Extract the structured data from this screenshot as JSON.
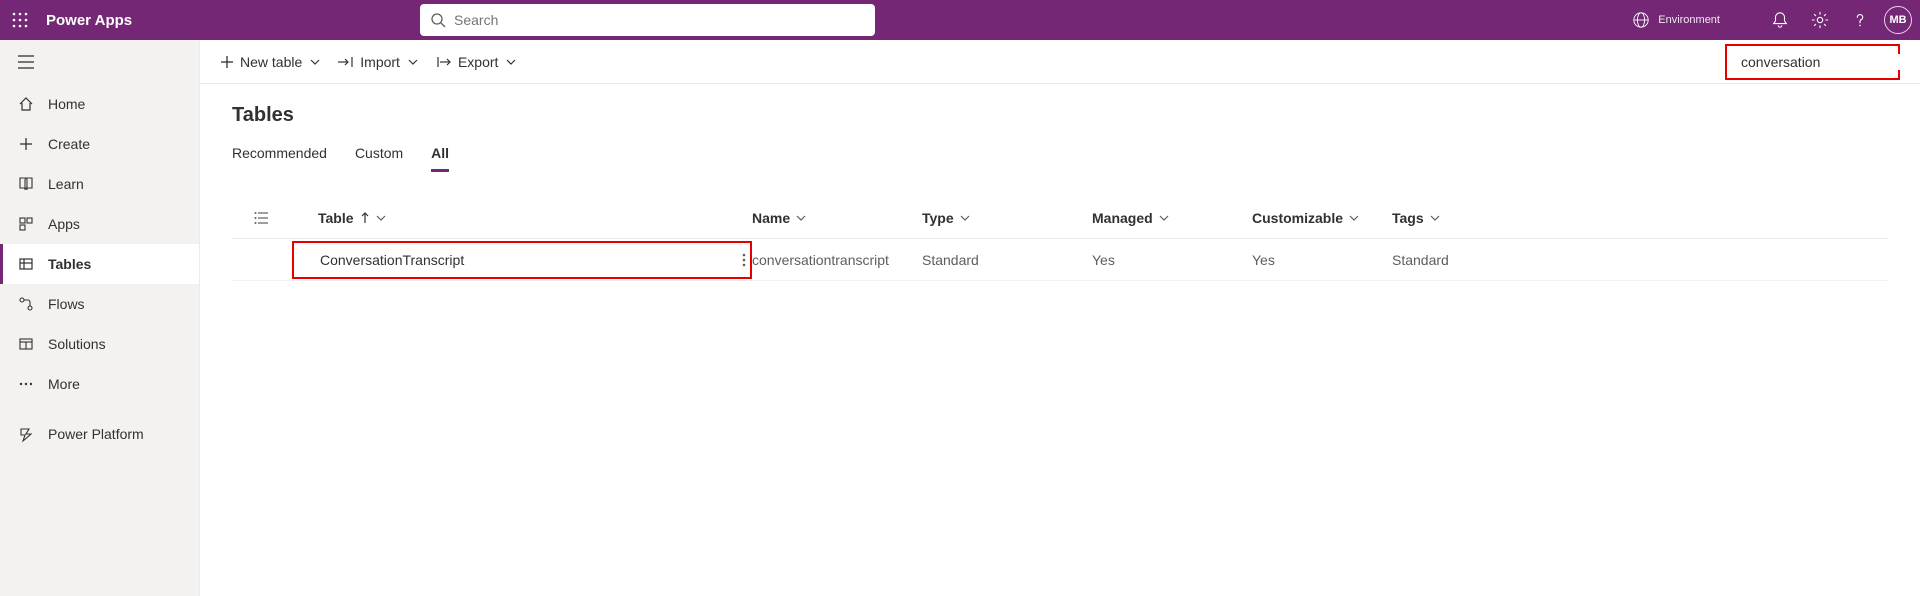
{
  "header": {
    "brand": "Power Apps",
    "search_placeholder": "Search",
    "env_label": "Environment",
    "avatar_initials": "MB"
  },
  "nav": {
    "home": "Home",
    "create": "Create",
    "learn": "Learn",
    "apps": "Apps",
    "tables": "Tables",
    "flows": "Flows",
    "solutions": "Solutions",
    "more": "More",
    "power_platform": "Power Platform"
  },
  "commands": {
    "new_table": "New table",
    "import": "Import",
    "export": "Export",
    "filter_value": "conversation"
  },
  "page": {
    "title": "Tables",
    "tabs": {
      "recommended": "Recommended",
      "custom": "Custom",
      "all": "All"
    }
  },
  "table": {
    "columns": {
      "table": "Table",
      "name": "Name",
      "type": "Type",
      "managed": "Managed",
      "customizable": "Customizable",
      "tags": "Tags"
    },
    "rows": [
      {
        "table": "ConversationTranscript",
        "name": "conversationtranscript",
        "type": "Standard",
        "managed": "Yes",
        "customizable": "Yes",
        "tags": "Standard"
      }
    ]
  }
}
